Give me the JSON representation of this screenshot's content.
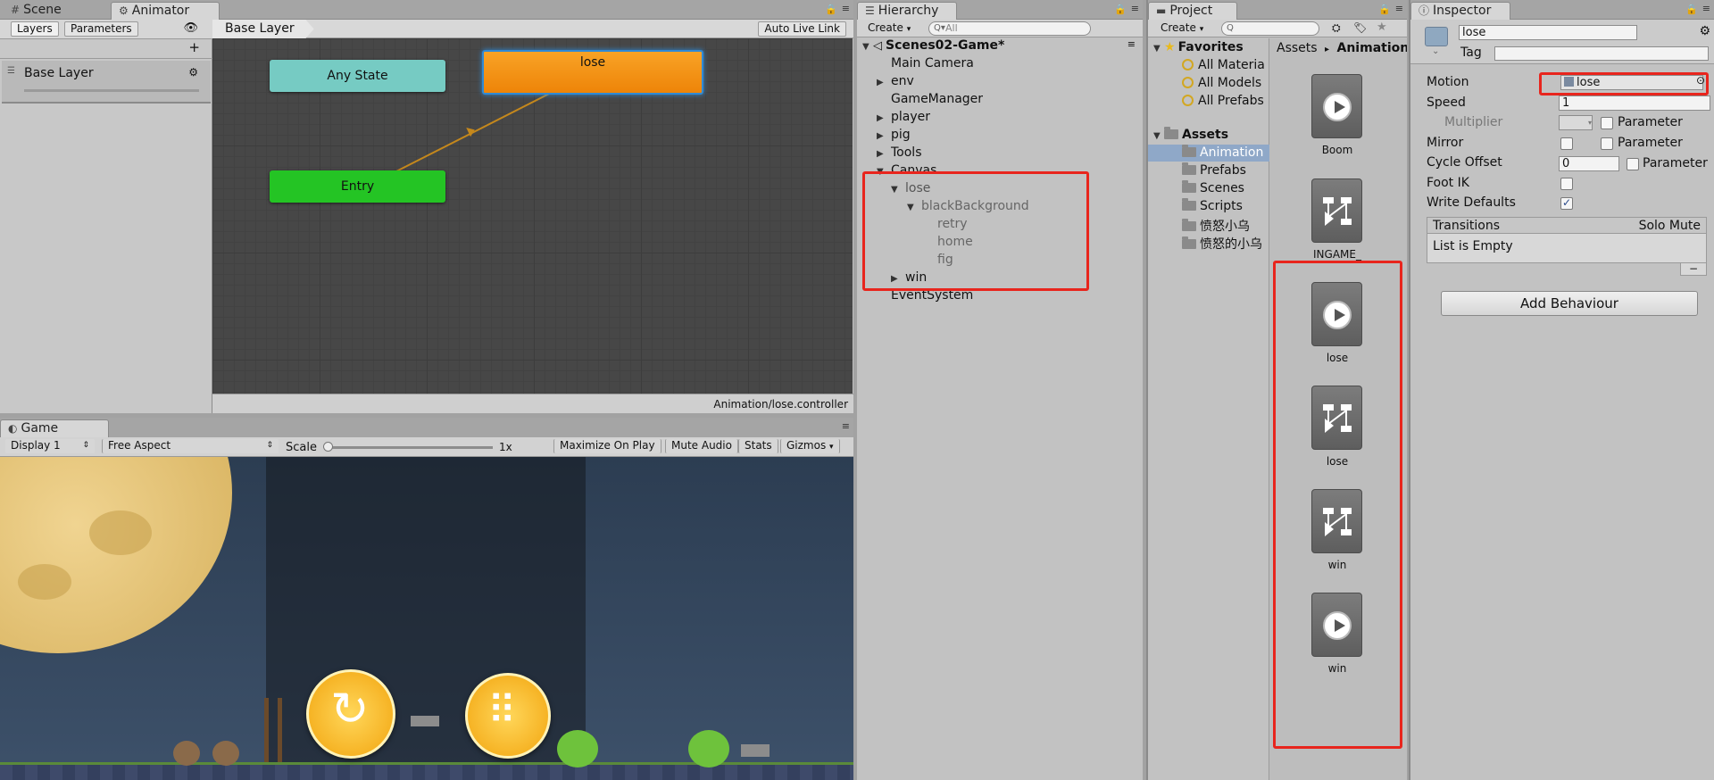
{
  "scene_tab": {
    "label": "Scene",
    "icon": "grid-icon"
  },
  "animator": {
    "tab_label": "Animator",
    "side_tabs": [
      "Layers",
      "Parameters"
    ],
    "plus": "+",
    "layer_name": "Base Layer",
    "breadcrumb": "Base Layer",
    "auto_live_link": "Auto Live Link",
    "nodes": {
      "any_state": "Any State",
      "lose": "lose",
      "entry": "Entry"
    },
    "node_colors": {
      "any_state": "#76cbc3",
      "lose": "#f2900f",
      "entry": "#24c424"
    },
    "footer_path": "Animation/lose.controller"
  },
  "game": {
    "tab_label": "Game",
    "display": "Display 1",
    "aspect": "Free Aspect",
    "scale_label": "Scale",
    "scale_value": "1x",
    "buttons": [
      "Maximize On Play",
      "Mute Audio",
      "Stats",
      "Gizmos"
    ]
  },
  "hierarchy": {
    "tab_label": "Hierarchy",
    "create": "Create",
    "search_placeholder": "All",
    "scene_name": "Scenes02-Game*",
    "items": {
      "main_camera": "Main Camera",
      "env": "env",
      "game_manager": "GameManager",
      "player": "player",
      "pig": "pig",
      "tools": "Tools",
      "canvas": "Canvas",
      "lose": "lose",
      "black_background": "blackBackground",
      "retry": "retry",
      "home": "home",
      "fig": "fig",
      "win": "win",
      "event_system": "EventSystem"
    }
  },
  "project": {
    "tab_label": "Project",
    "create": "Create",
    "favorites_label": "Favorites",
    "favorites": [
      "All Materia",
      "All Models",
      "All Prefabs"
    ],
    "assets_label": "Assets",
    "folders": [
      "Animation",
      "Prefabs",
      "Scenes",
      "Scripts",
      "愤怒小乌",
      "愤怒的小乌"
    ],
    "breadcrumb": {
      "root": "Assets",
      "sep": "▸",
      "current": "Animation"
    },
    "assets": [
      {
        "name": "Boom",
        "kind": "clip"
      },
      {
        "name": "INGAME_",
        "kind": "controller"
      },
      {
        "name": "lose",
        "kind": "clip"
      },
      {
        "name": "lose",
        "kind": "controller"
      },
      {
        "name": "win",
        "kind": "controller"
      },
      {
        "name": "win",
        "kind": "clip"
      }
    ]
  },
  "inspector": {
    "tab_label": "Inspector",
    "name": "lose",
    "tag_label": "Tag",
    "motion_label": "Motion",
    "motion_value": "lose",
    "speed_label": "Speed",
    "speed_value": "1",
    "multiplier_label": "Multiplier",
    "parameter_label": "Parameter",
    "mirror_label": "Mirror",
    "cycle_offset_label": "Cycle Offset",
    "cycle_offset_value": "0",
    "foot_ik_label": "Foot IK",
    "write_defaults_label": "Write Defaults",
    "transitions_label": "Transitions",
    "solo_mute": "Solo Mute",
    "list_empty": "List is Empty",
    "minus": "−",
    "add_behaviour": "Add Behaviour"
  }
}
